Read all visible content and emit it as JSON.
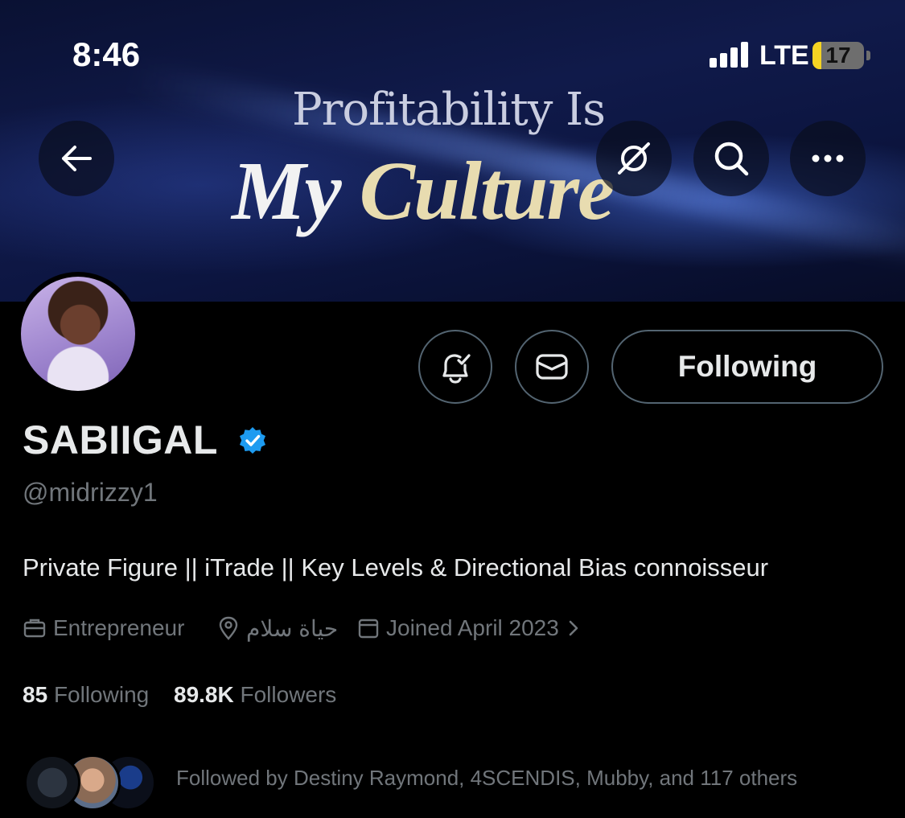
{
  "status_bar": {
    "time": "8:46",
    "network": "LTE",
    "battery": "17",
    "battery_level": 0.17
  },
  "banner": {
    "headline_line1": "Profitability Is",
    "headline_word1": "My",
    "headline_word2": "Culture",
    "colors": {
      "background": "#0c1540",
      "accent": "#e8dcb0"
    }
  },
  "header_buttons": {
    "back_icon": "arrow-left-icon",
    "grok_icon": "grok-icon",
    "search_icon": "search-icon",
    "more_icon": "ellipsis-icon"
  },
  "actions": {
    "notifications_icon": "bell-check-icon",
    "message_icon": "envelope-icon",
    "following_label": "Following"
  },
  "profile": {
    "display_name": "SABIIGAL",
    "handle": "@midrizzy1",
    "bio": "Private Figure || iTrade || Key Levels & Directional Bias connoisseur",
    "verified_color": "#1d9bf0",
    "meta": {
      "category": "Entrepreneur",
      "location": "حياة سلام",
      "joined": "Joined April 2023"
    },
    "stats": {
      "following_count": "85",
      "following_label": "Following",
      "followers_count": "89.8K",
      "followers_label": "Followers"
    },
    "followed_by": "Followed by Destiny Raymond, 4SCENDIS, Mubby, and 117 others"
  }
}
